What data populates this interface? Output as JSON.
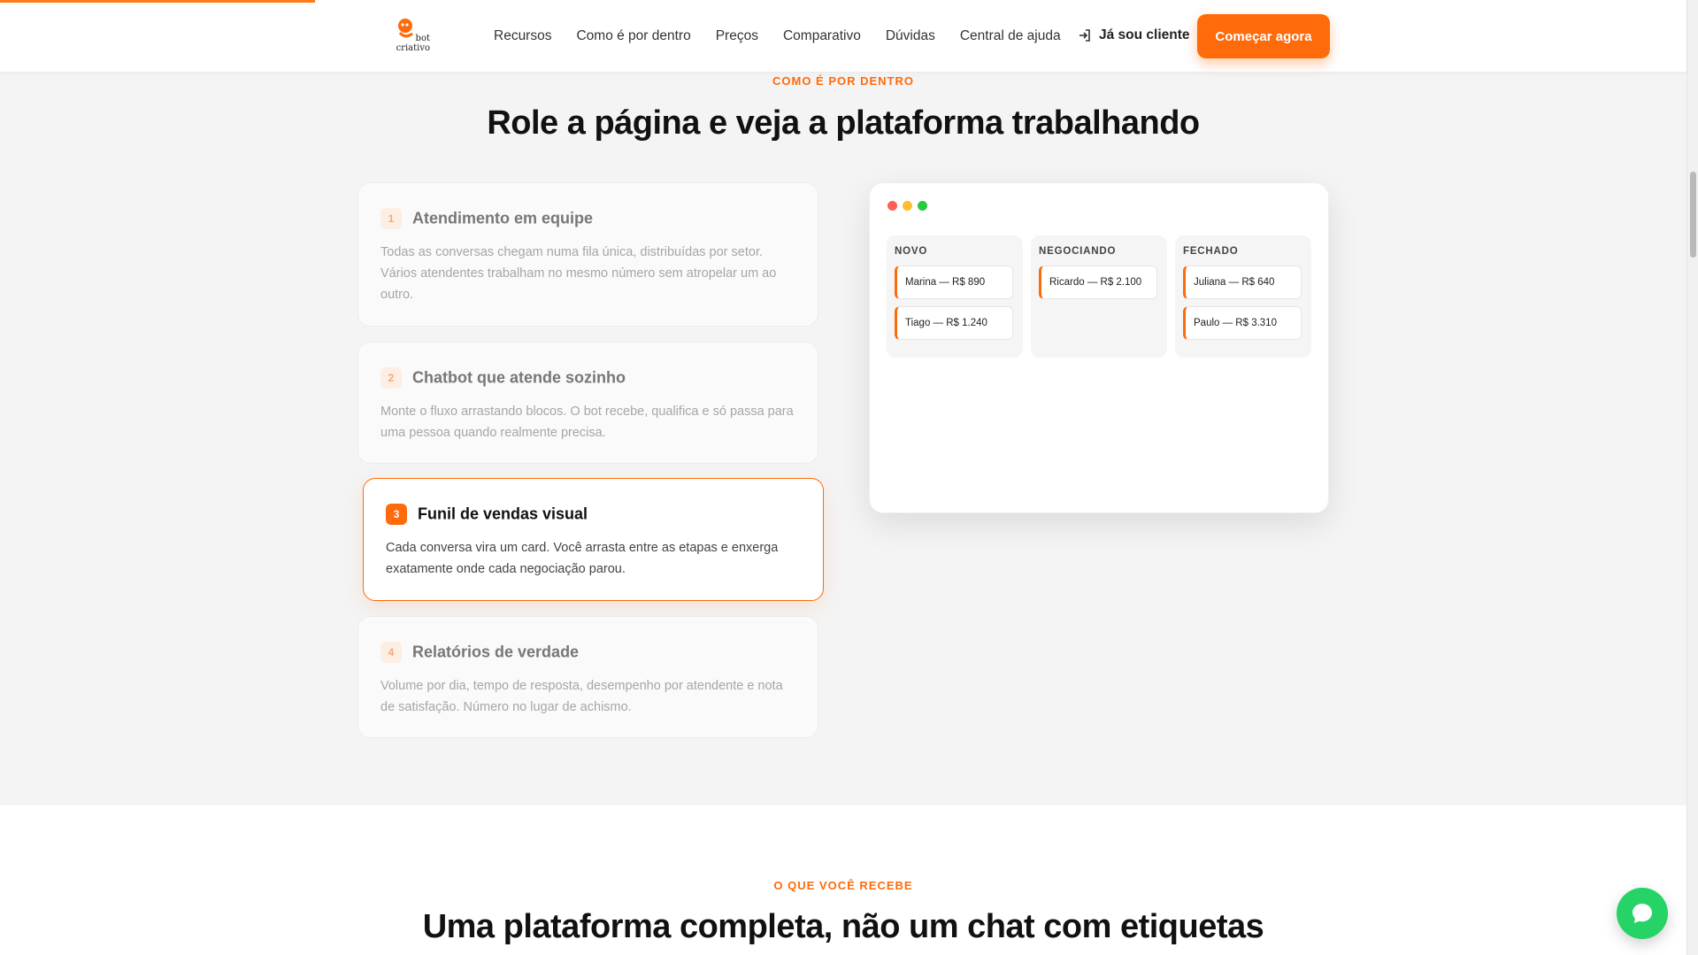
{
  "header": {
    "logo_lines": [
      "bot",
      "criativo"
    ],
    "nav": [
      "Recursos",
      "Como é por dentro",
      "Preços",
      "Comparativo",
      "Dúvidas",
      "Central de ajuda"
    ],
    "login_label": "Já sou cliente",
    "cta_label": "Começar agora"
  },
  "section1": {
    "eyebrow": "COMO É POR DENTRO",
    "title": "Role a página e veja a plataforma trabalhando",
    "steps": [
      {
        "num": "1",
        "title": "Atendimento em equipe",
        "desc": "Todas as conversas chegam numa fila única, distribuídas por setor. Vários atendentes trabalham no mesmo número sem atropelar um ao outro."
      },
      {
        "num": "2",
        "title": "Chatbot que atende sozinho",
        "desc": "Monte o fluxo arrastando blocos. O bot recebe, qualifica e só passa para uma pessoa quando realmente precisa."
      },
      {
        "num": "3",
        "title": "Funil de vendas visual",
        "desc": "Cada conversa vira um card. Você arrasta entre as etapas e enxerga exatamente onde cada negociação parou."
      },
      {
        "num": "4",
        "title": "Relatórios de verdade",
        "desc": "Volume por dia, tempo de resposta, desempenho por atendente e nota de satisfação. Número no lugar de achismo."
      }
    ],
    "active_step": 3,
    "kanban": {
      "columns": [
        {
          "title": "NOVO",
          "cards": [
            "Marina — R$ 890",
            "Tiago — R$ 1.240"
          ]
        },
        {
          "title": "NEGOCIANDO",
          "cards": [
            "Ricardo — R$ 2.100"
          ]
        },
        {
          "title": "FECHADO",
          "cards": [
            "Juliana — R$ 640",
            "Paulo — R$ 3.310"
          ]
        }
      ]
    }
  },
  "section2": {
    "eyebrow": "O QUE VOCÊ RECEBE",
    "title": "Uma plataforma completa, não um chat com etiquetas"
  },
  "colors": {
    "accent": "#ff6a0a",
    "window_dots": [
      "#ff5f57",
      "#febc2e",
      "#28c840"
    ],
    "chat_button": "#25d366"
  }
}
